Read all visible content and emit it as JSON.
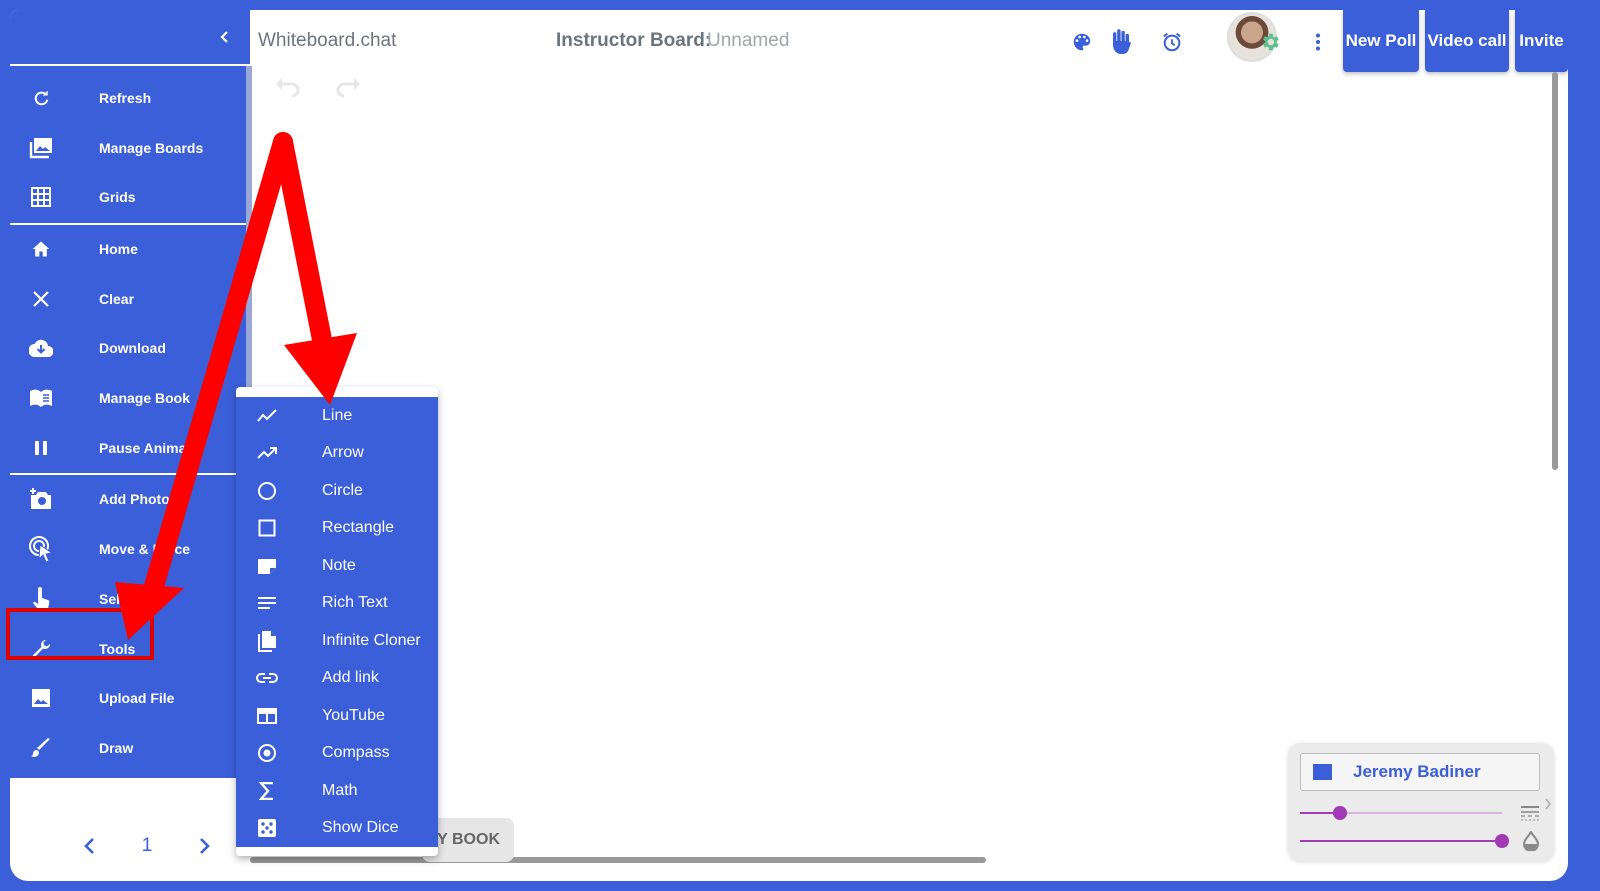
{
  "header": {
    "app_title": "Whiteboard.chat",
    "board_label": "Instructor Board:",
    "board_name": "Unnamed",
    "buttons": {
      "new_poll": "New Poll",
      "video_call": "Video call",
      "invite": "Invite"
    },
    "icons": [
      "palette-icon",
      "raise-hand-icon",
      "alarm-icon",
      "settings-gear-icon",
      "more-vert-icon"
    ],
    "accent_color": "#3b5fd9",
    "gear_color": "#5fbf8f"
  },
  "sidebar": {
    "items": [
      {
        "label": "Refresh",
        "icon": "refresh-icon"
      },
      {
        "label": "Manage Boards",
        "icon": "photo-library-icon"
      },
      {
        "label": "Grids",
        "icon": "grid-icon"
      },
      {
        "label": "Home",
        "icon": "home-icon"
      },
      {
        "label": "Clear",
        "icon": "close-icon"
      },
      {
        "label": "Download",
        "icon": "cloud-download-icon"
      },
      {
        "label": "Manage Book",
        "icon": "book-icon"
      },
      {
        "label": "Pause Animati",
        "icon": "pause-icon"
      },
      {
        "label": "Add Photo",
        "icon": "add-photo-icon"
      },
      {
        "label": "Move & Re  ce",
        "icon": "move-pointer-icon"
      },
      {
        "label": "Selec",
        "icon": "touch-select-icon"
      },
      {
        "label": "Tools",
        "icon": "wrench-icon"
      },
      {
        "label": "Upload File",
        "icon": "image-icon"
      },
      {
        "label": "Draw",
        "icon": "brush-icon"
      }
    ],
    "page": "1"
  },
  "tools_menu": {
    "items": [
      {
        "label": "Line",
        "icon": "line-chart-icon"
      },
      {
        "label": "Arrow",
        "icon": "trending-up-icon"
      },
      {
        "label": "Circle",
        "icon": "circle-outline-icon"
      },
      {
        "label": "Rectangle",
        "icon": "square-outline-icon"
      },
      {
        "label": "Note",
        "icon": "note-icon"
      },
      {
        "label": "Rich Text",
        "icon": "text-lines-icon"
      },
      {
        "label": "Infinite Cloner",
        "icon": "copy-file-icon"
      },
      {
        "label": "Add link",
        "icon": "link-icon"
      },
      {
        "label": "YouTube",
        "icon": "video-frame-icon"
      },
      {
        "label": "Compass",
        "icon": "radio-target-icon"
      },
      {
        "label": "Math",
        "icon": "sigma-icon"
      },
      {
        "label": "Show Dice",
        "icon": "dice-icon"
      }
    ]
  },
  "book_tab": {
    "label": "Y BOOK"
  },
  "user_panel": {
    "name": "Jeremy Badiner",
    "swatch_color": "#3b5fd9",
    "stroke_size_level": 0.2,
    "opacity_level": 1.0,
    "slider_color": "#a23ab5"
  },
  "annotation": {
    "arrow_color": "#ff0000",
    "highlight_color": "#e00000"
  }
}
